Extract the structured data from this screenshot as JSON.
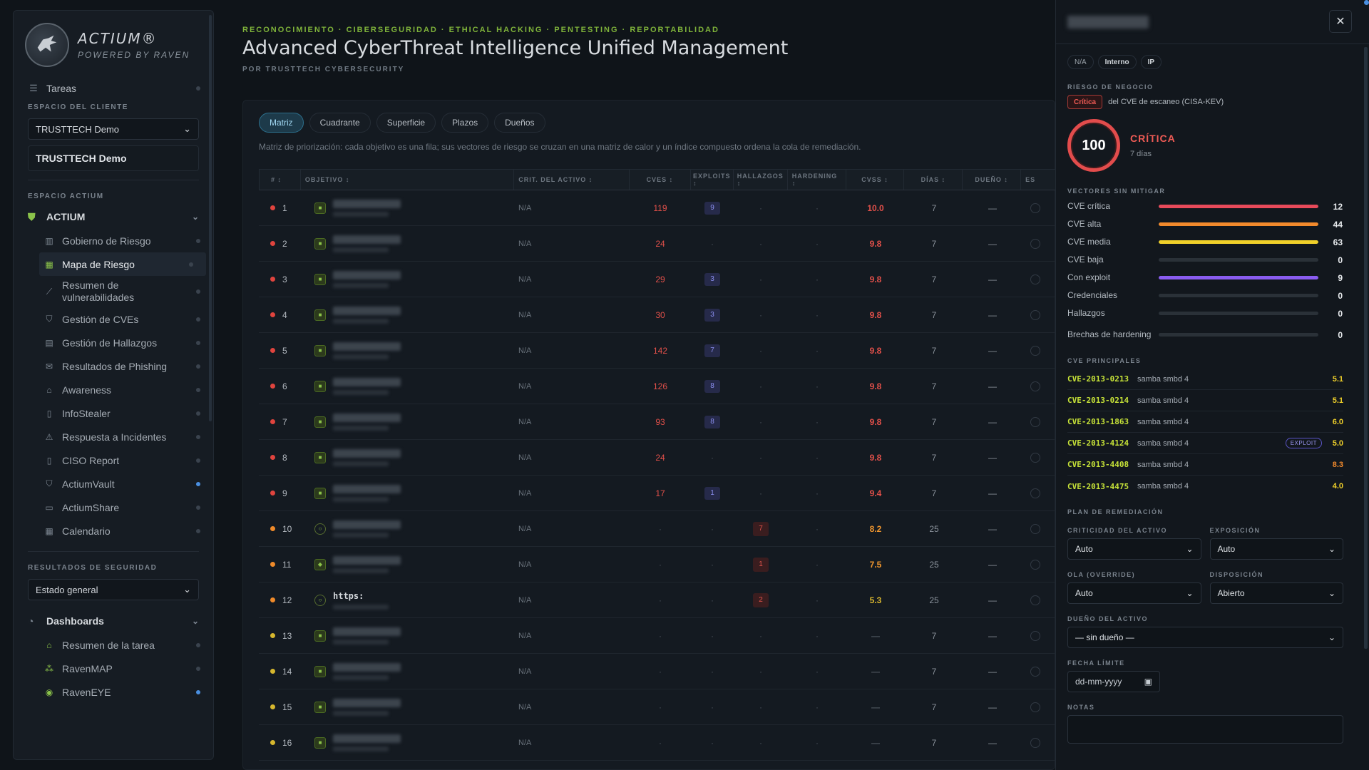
{
  "sidebar": {
    "brand": {
      "name": "ACTIUM®",
      "sub": "POWERED BY RAVEN"
    },
    "tasks_label": "Tareas",
    "client_section": "ESPACIO DEL CLIENTE",
    "client_select": "TRUSTTECH Demo",
    "client_name": "TRUSTTECH Demo",
    "actium_section": "ESPACIO ACTIUM",
    "actium_group": "ACTIUM",
    "items": [
      {
        "label": "Gobierno de Riesgo",
        "icon": "bank-icon",
        "dot": "gray"
      },
      {
        "label": "Mapa de Riesgo",
        "icon": "grid-icon",
        "dot": "gray"
      },
      {
        "label": "Resumen de vulnerabilidades",
        "icon": "chart-line-icon",
        "dot": "gray"
      },
      {
        "label": "Gestión de CVEs",
        "icon": "shield-icon",
        "dot": "gray"
      },
      {
        "label": "Gestión de Hallazgos",
        "icon": "clipboard-icon",
        "dot": "gray"
      },
      {
        "label": "Resultados de Phishing",
        "icon": "mail-icon",
        "dot": "gray"
      },
      {
        "label": "Awareness",
        "icon": "graduation-cap-icon",
        "dot": "gray"
      },
      {
        "label": "InfoStealer",
        "icon": "document-icon",
        "dot": "gray"
      },
      {
        "label": "Respuesta a Incidentes",
        "icon": "warning-icon",
        "dot": "gray"
      },
      {
        "label": "CISO Report",
        "icon": "report-icon",
        "dot": "gray"
      },
      {
        "label": "ActiumVault",
        "icon": "shield-icon",
        "dot": "blue"
      },
      {
        "label": "ActiumShare",
        "icon": "share-icon",
        "dot": "gray"
      },
      {
        "label": "Calendario",
        "icon": "calendar-icon",
        "dot": "gray"
      }
    ],
    "results_section": "RESULTADOS DE SEGURIDAD",
    "results_select": "Estado general",
    "dash_group": "Dashboards",
    "dash_items": [
      {
        "label": "Resumen de la tarea",
        "icon": "home-icon",
        "dot": "gray"
      },
      {
        "label": "RavenMAP",
        "icon": "network-icon",
        "dot": "gray"
      },
      {
        "label": "RavenEYE",
        "icon": "eye-icon",
        "dot": "blue"
      }
    ]
  },
  "header": {
    "breadcrumb": "RECONOCIMIENTO · CIBERSEGURIDAD · ETHICAL HACKING · PENTESTING · REPORTABILIDAD",
    "title": "Advanced CyberThreat Intelligence Unified Management",
    "byline": "POR TRUSTTECH CYBERSECURITY"
  },
  "tabs": [
    "Matriz",
    "Cuadrante",
    "Superficie",
    "Plazos",
    "Dueños"
  ],
  "description": "Matriz de priorización: cada objetivo es una fila; sus vectores de riesgo se cruzan en una matriz de calor y un índice compuesto ordena la cola de remediación.",
  "table": {
    "headers": [
      "# ↕",
      "OBJETIVO ↕",
      "CRIT. DEL ACTIVO ↕",
      "CVES ↕",
      "EXPLOITS ↕",
      "HALLAZGOS ↕",
      "HARDENING ↕",
      "CVSS ↕",
      "DÍAS ↕",
      "DUEÑO ↕",
      "ES"
    ],
    "rows": [
      {
        "n": "1",
        "sev": "red",
        "kind": "square",
        "url": "",
        "crit": "N/A",
        "cves": "119",
        "exploits": "9",
        "hall": "",
        "hard": "·",
        "cvss": "10.0",
        "cvss_c": "red",
        "days": "7",
        "owner": "—"
      },
      {
        "n": "2",
        "sev": "red",
        "kind": "square",
        "url": "",
        "crit": "N/A",
        "cves": "24",
        "exploits": "",
        "hall": "",
        "hard": "·",
        "cvss": "9.8",
        "cvss_c": "red",
        "days": "7",
        "owner": "—"
      },
      {
        "n": "3",
        "sev": "red",
        "kind": "square",
        "url": "",
        "crit": "N/A",
        "cves": "29",
        "exploits": "3",
        "hall": "",
        "hard": "·",
        "cvss": "9.8",
        "cvss_c": "red",
        "days": "7",
        "owner": "—"
      },
      {
        "n": "4",
        "sev": "red",
        "kind": "square",
        "url": "",
        "crit": "N/A",
        "cves": "30",
        "exploits": "3",
        "hall": "",
        "hard": "·",
        "cvss": "9.8",
        "cvss_c": "red",
        "days": "7",
        "owner": "—"
      },
      {
        "n": "5",
        "sev": "red",
        "kind": "square",
        "url": "",
        "crit": "N/A",
        "cves": "142",
        "exploits": "7",
        "hall": "",
        "hard": "·",
        "cvss": "9.8",
        "cvss_c": "red",
        "days": "7",
        "owner": "—"
      },
      {
        "n": "6",
        "sev": "red",
        "kind": "square",
        "url": "",
        "crit": "N/A",
        "cves": "126",
        "exploits": "8",
        "hall": "",
        "hard": "·",
        "cvss": "9.8",
        "cvss_c": "red",
        "days": "7",
        "owner": "—"
      },
      {
        "n": "7",
        "sev": "red",
        "kind": "square",
        "url": "",
        "crit": "N/A",
        "cves": "93",
        "exploits": "8",
        "hall": "",
        "hard": "·",
        "cvss": "9.8",
        "cvss_c": "red",
        "days": "7",
        "owner": "—"
      },
      {
        "n": "8",
        "sev": "red",
        "kind": "square",
        "url": "",
        "crit": "N/A",
        "cves": "24",
        "exploits": "",
        "hall": "",
        "hard": "·",
        "cvss": "9.8",
        "cvss_c": "red",
        "days": "7",
        "owner": "—"
      },
      {
        "n": "9",
        "sev": "red",
        "kind": "square",
        "url": "",
        "crit": "N/A",
        "cves": "17",
        "exploits": "1",
        "hall": "",
        "hard": "·",
        "cvss": "9.4",
        "cvss_c": "red",
        "days": "7",
        "owner": "—"
      },
      {
        "n": "10",
        "sev": "orange",
        "kind": "circle",
        "url": "",
        "crit": "N/A",
        "cves": "·",
        "exploits": "",
        "hall": "7",
        "hard": "·",
        "cvss": "8.2",
        "cvss_c": "orange",
        "days": "25",
        "owner": "—"
      },
      {
        "n": "11",
        "sev": "orange",
        "kind": "diamond",
        "url": "",
        "crit": "N/A",
        "cves": "·",
        "exploits": "",
        "hall": "1",
        "hard": "·",
        "cvss": "7.5",
        "cvss_c": "orange",
        "days": "25",
        "owner": "—"
      },
      {
        "n": "12",
        "sev": "orange",
        "kind": "circle",
        "url": "https:",
        "crit": "N/A",
        "cves": "·",
        "exploits": "",
        "hall": "2",
        "hard": "·",
        "cvss": "5.3",
        "cvss_c": "yellow",
        "days": "25",
        "owner": "—"
      },
      {
        "n": "13",
        "sev": "yellow",
        "kind": "square",
        "url": "",
        "crit": "N/A",
        "cves": "·",
        "exploits": "",
        "hall": "",
        "hard": "·",
        "cvss": "—",
        "cvss_c": "dim",
        "days": "7",
        "owner": "—"
      },
      {
        "n": "14",
        "sev": "yellow",
        "kind": "square",
        "url": "",
        "crit": "N/A",
        "cves": "·",
        "exploits": "",
        "hall": "",
        "hard": "·",
        "cvss": "—",
        "cvss_c": "dim",
        "days": "7",
        "owner": "—"
      },
      {
        "n": "15",
        "sev": "yellow",
        "kind": "square",
        "url": "",
        "crit": "N/A",
        "cves": "·",
        "exploits": "",
        "hall": "",
        "hard": "·",
        "cvss": "—",
        "cvss_c": "dim",
        "days": "7",
        "owner": "—"
      },
      {
        "n": "16",
        "sev": "yellow",
        "kind": "square",
        "url": "",
        "crit": "N/A",
        "cves": "·",
        "exploits": "",
        "hall": "",
        "hard": "·",
        "cvss": "—",
        "cvss_c": "dim",
        "days": "7",
        "owner": "—"
      }
    ]
  },
  "drawer": {
    "chips": [
      "N/A",
      "Interno",
      "IP"
    ],
    "risk_label": "RIESGO DE NEGOCIO",
    "risk_chip": "Crítica",
    "risk_text": "del CVE de escaneo (CISA-KEV)",
    "score": "100",
    "score_label": "CRÍTICA",
    "score_days": "7 días",
    "vectors_label": "VECTORES SIN MITIGAR",
    "vectors": [
      {
        "label": "CVE crítica",
        "value": "12",
        "fill": 1.0,
        "color": "#e84a5a"
      },
      {
        "label": "CVE alta",
        "value": "44",
        "fill": 1.0,
        "color": "#f28a2c"
      },
      {
        "label": "CVE media",
        "value": "63",
        "fill": 1.0,
        "color": "#f0d02a"
      },
      {
        "label": "CVE baja",
        "value": "0",
        "fill": 0,
        "color": "#6b7580"
      },
      {
        "label": "Con exploit",
        "value": "9",
        "fill": 1.0,
        "color": "#8a5cf0"
      },
      {
        "label": "Credenciales",
        "value": "0",
        "fill": 0,
        "color": "#6b7580"
      },
      {
        "label": "Hallazgos",
        "value": "0",
        "fill": 0,
        "color": "#6b7580"
      },
      {
        "label": "Brechas de hardening",
        "value": "0",
        "fill": 0,
        "color": "#6b7580"
      }
    ],
    "cves_label": "CVE PRINCIPALES",
    "cves": [
      {
        "id": "CVE-2013-0213",
        "pkg": "samba smbd 4",
        "exploit": "",
        "score": "5.1",
        "color": "#f0d02a"
      },
      {
        "id": "CVE-2013-0214",
        "pkg": "samba smbd 4",
        "exploit": "",
        "score": "5.1",
        "color": "#f0d02a"
      },
      {
        "id": "CVE-2013-1863",
        "pkg": "samba smbd 4",
        "exploit": "",
        "score": "6.0",
        "color": "#f0d02a"
      },
      {
        "id": "CVE-2013-4124",
        "pkg": "samba smbd 4",
        "exploit": "EXPLOIT",
        "score": "5.0",
        "color": "#f0d02a"
      },
      {
        "id": "CVE-2013-4408",
        "pkg": "samba smbd 4",
        "exploit": "",
        "score": "8.3",
        "color": "#f28a2c"
      },
      {
        "id": "CVE-2013-4475",
        "pkg": "samba smbd 4",
        "exploit": "",
        "score": "4.0",
        "color": "#f0d02a"
      }
    ],
    "plan_label": "PLAN DE REMEDIACIÓN",
    "fields": {
      "criticality_label": "CRITICIDAD DEL ACTIVO",
      "criticality": "Auto",
      "exposure_label": "EXPOSICIÓN",
      "exposure": "Auto",
      "wave_label": "OLA (OVERRIDE)",
      "wave": "Auto",
      "disposition_label": "DISPOSICIÓN",
      "disposition": "Abierto",
      "owner_label": "DUEÑO DEL ACTIVO",
      "owner": "— sin dueño —",
      "deadline_label": "FECHA LÍMITE",
      "deadline_placeholder": "dd-mm-yyyy",
      "notes_label": "NOTAS"
    }
  }
}
